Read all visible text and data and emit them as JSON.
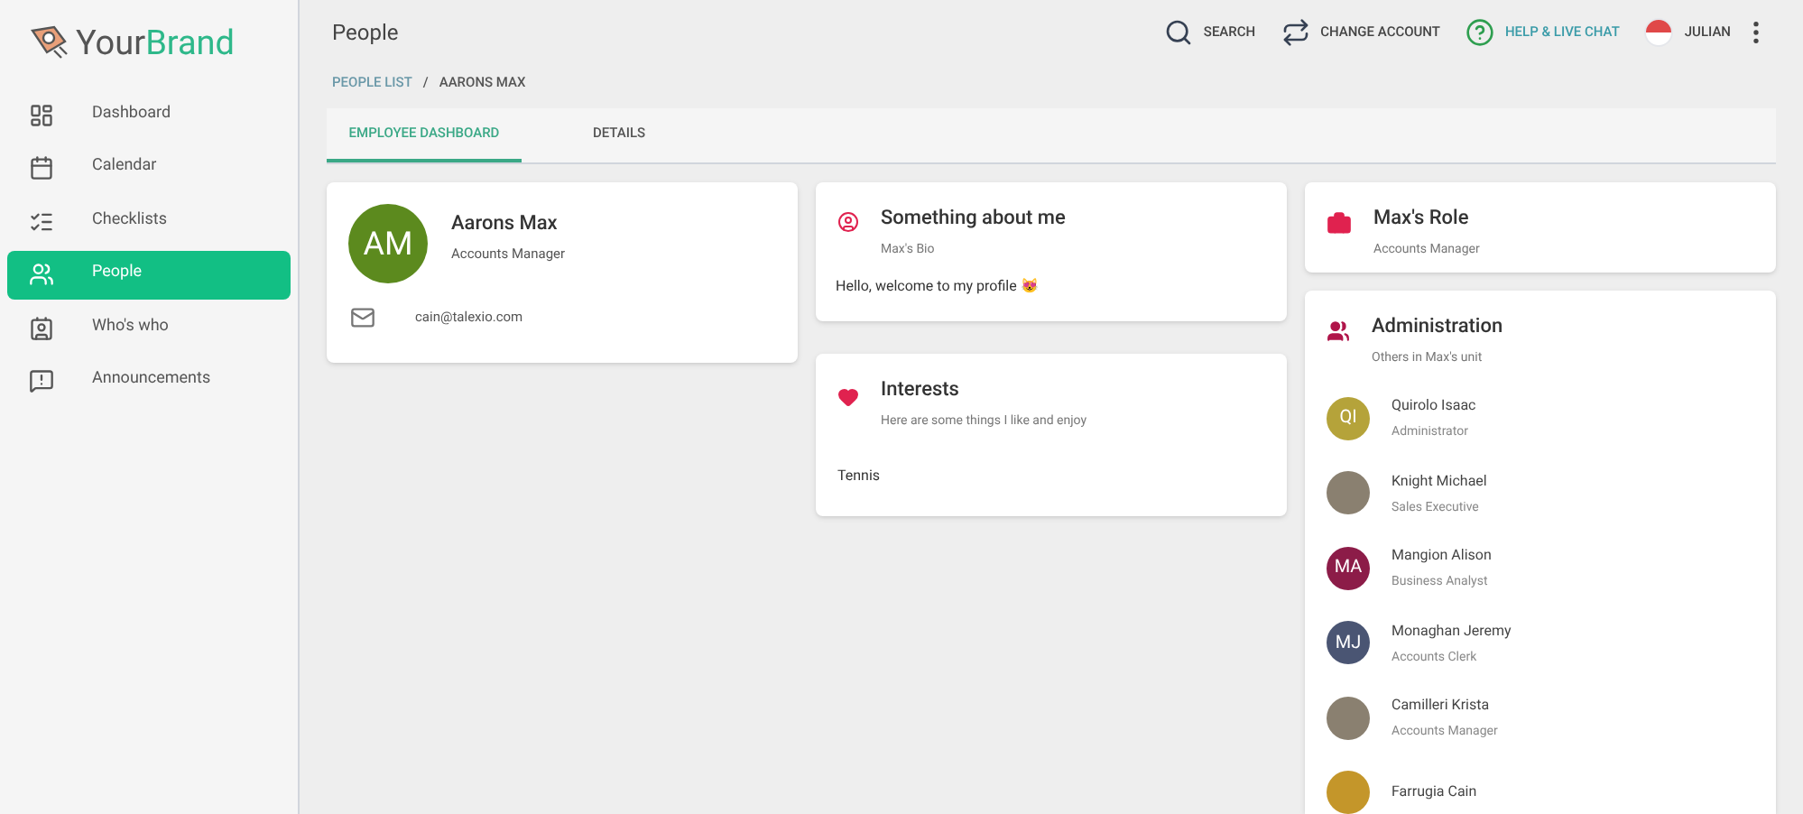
{
  "brand": {
    "part_1": "Your",
    "part_2": "Brand"
  },
  "sidebar": {
    "items": [
      {
        "label": "Dashboard",
        "kind": "dashboard",
        "selected": false
      },
      {
        "label": "Calendar",
        "kind": "calendar",
        "selected": false
      },
      {
        "label": "Checklists",
        "kind": "checklist",
        "selected": false
      },
      {
        "label": "People",
        "kind": "people",
        "selected": true
      },
      {
        "label": "Who's who",
        "kind": "badge",
        "selected": false
      },
      {
        "label": "Announcements",
        "kind": "announcement",
        "selected": false
      }
    ]
  },
  "header": {
    "title": "People",
    "actions": [
      {
        "label": "SEARCH",
        "kind": "search"
      },
      {
        "label": "CHANGE ACCOUNT",
        "kind": "swap"
      },
      {
        "label": "HELP & LIVE CHAT",
        "kind": "help"
      },
      {
        "label": "JULIAN",
        "kind": "avatar"
      }
    ]
  },
  "breadcrumb": [
    "PEOPLE LIST",
    "/",
    "AARONS MAX"
  ],
  "tabs": [
    {
      "label": "EMPLOYEE DASHBOARD",
      "selected": true
    },
    {
      "label": "DETAILS",
      "selected": false
    }
  ],
  "profile": {
    "initials": "AM",
    "name": "Aarons Max",
    "role": "Accounts Manager",
    "email": "cain@talexio.com"
  },
  "about": {
    "title": "Something about me",
    "subtitle": "Max's Bio",
    "text": "Hello, welcome to my profile 😻"
  },
  "interests": {
    "title": "Interests",
    "subtitle": "Here are some things I like and enjoy",
    "items": [
      "Tennis"
    ]
  },
  "role_card": {
    "title": "Max's Role",
    "subtitle": "Accounts Manager"
  },
  "unit": {
    "title": "Administration",
    "subtitle": "Others in Max's unit",
    "members": [
      {
        "kind": "initials",
        "initials": "QI",
        "color": "#b5a33a",
        "name": "Quirolo Isaac",
        "role": "Administrator"
      },
      {
        "kind": "photo",
        "name": "Knight Michael",
        "role": "Sales Executive"
      },
      {
        "kind": "initials",
        "initials": "MA",
        "color": "#8c1c48",
        "name": "Mangion Alison",
        "role": "Business Analyst"
      },
      {
        "kind": "initials",
        "initials": "MJ",
        "color": "#4a5573",
        "name": "Monaghan Jeremy",
        "role": "Accounts Clerk"
      },
      {
        "kind": "photo",
        "name": "Camilleri Krista",
        "role": "Accounts Manager"
      },
      {
        "kind": "initials",
        "color": "#c4962a",
        "name": "Farrugia Cain"
      }
    ]
  }
}
